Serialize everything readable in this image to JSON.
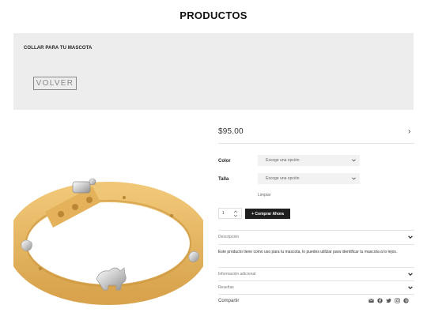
{
  "page_title": "PRODUCTOS",
  "banner": {
    "product_name": "COLLAR PARA TU MASCOTA",
    "back_label": "VOLVER"
  },
  "product": {
    "price": "$95.00",
    "attributes": [
      {
        "label": "Color",
        "placeholder": "Escoge una opción"
      },
      {
        "label": "Talla",
        "placeholder": "Escoge una opción"
      }
    ],
    "clear_label": "Limpiar",
    "quantity": "1",
    "buy_label": "+ Comprar Ahora"
  },
  "accordion": {
    "description": {
      "label": "Descripción",
      "text": "Este producto tiene como uso para tu mascota, lo puedes utilizar para identificar tu mascota a lo lejos."
    },
    "additional": {
      "label": "Información adicional"
    },
    "reviews": {
      "label": "Reseñas"
    },
    "share": {
      "label": "Compartir"
    }
  },
  "share_icons": [
    "email-icon",
    "facebook-icon",
    "twitter-icon",
    "instagram-icon",
    "pinterest-icon"
  ],
  "colors": {
    "collar": "#e6b65c",
    "buy_button": "#1e1e1e",
    "banner": "#ededed"
  }
}
